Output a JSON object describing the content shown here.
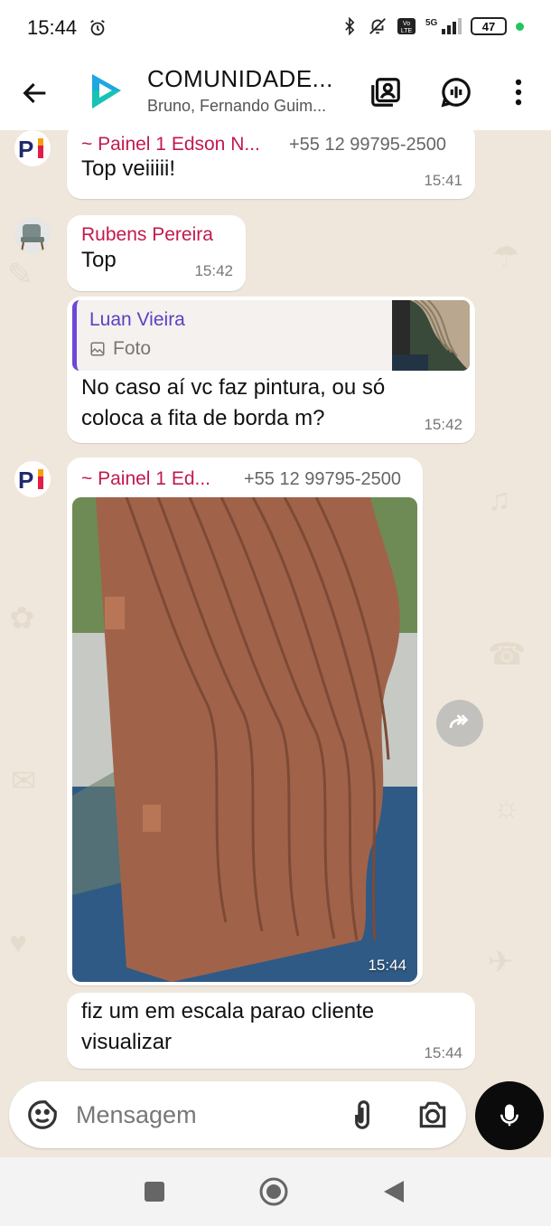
{
  "status_bar": {
    "time": "15:44",
    "battery": "47"
  },
  "header": {
    "title": "COMUNIDADE...",
    "subtitle": "Bruno, Fernando Guim...",
    "colors": {
      "avatar_blue": "#1ea7e1",
      "avatar_teal": "#17c3b2"
    }
  },
  "messages": [
    {
      "sender": "~ Painel 1 Edson N...",
      "phone": "+55 12 99795-2500",
      "text": "Top veiiiii!",
      "time": "15:41"
    },
    {
      "sender": "Rubens Pereira",
      "text": "Top",
      "time": "15:42"
    },
    {
      "quote": {
        "name": "Luan Vieira",
        "type": "Foto"
      },
      "text": "No caso aí vc faz pintura, ou só coloca a fita de borda m?",
      "time": "15:42"
    },
    {
      "sender": "~ Painel 1 Ed...",
      "phone": "+55 12 99795-2500",
      "photo_time": "15:44"
    },
    {
      "text": "fiz um em escala parao cliente visualizar",
      "time": "15:44"
    }
  ],
  "composer": {
    "placeholder": "Mensagem"
  },
  "icons": {
    "back": "arrow-left-icon",
    "call": "call-icon",
    "gallery": "group-members-icon",
    "menu": "more-vertical-icon",
    "sticker": "sticker-icon",
    "attach": "paperclip-icon",
    "camera": "camera-icon",
    "mic": "microphone-icon",
    "forward": "forward-icon"
  }
}
